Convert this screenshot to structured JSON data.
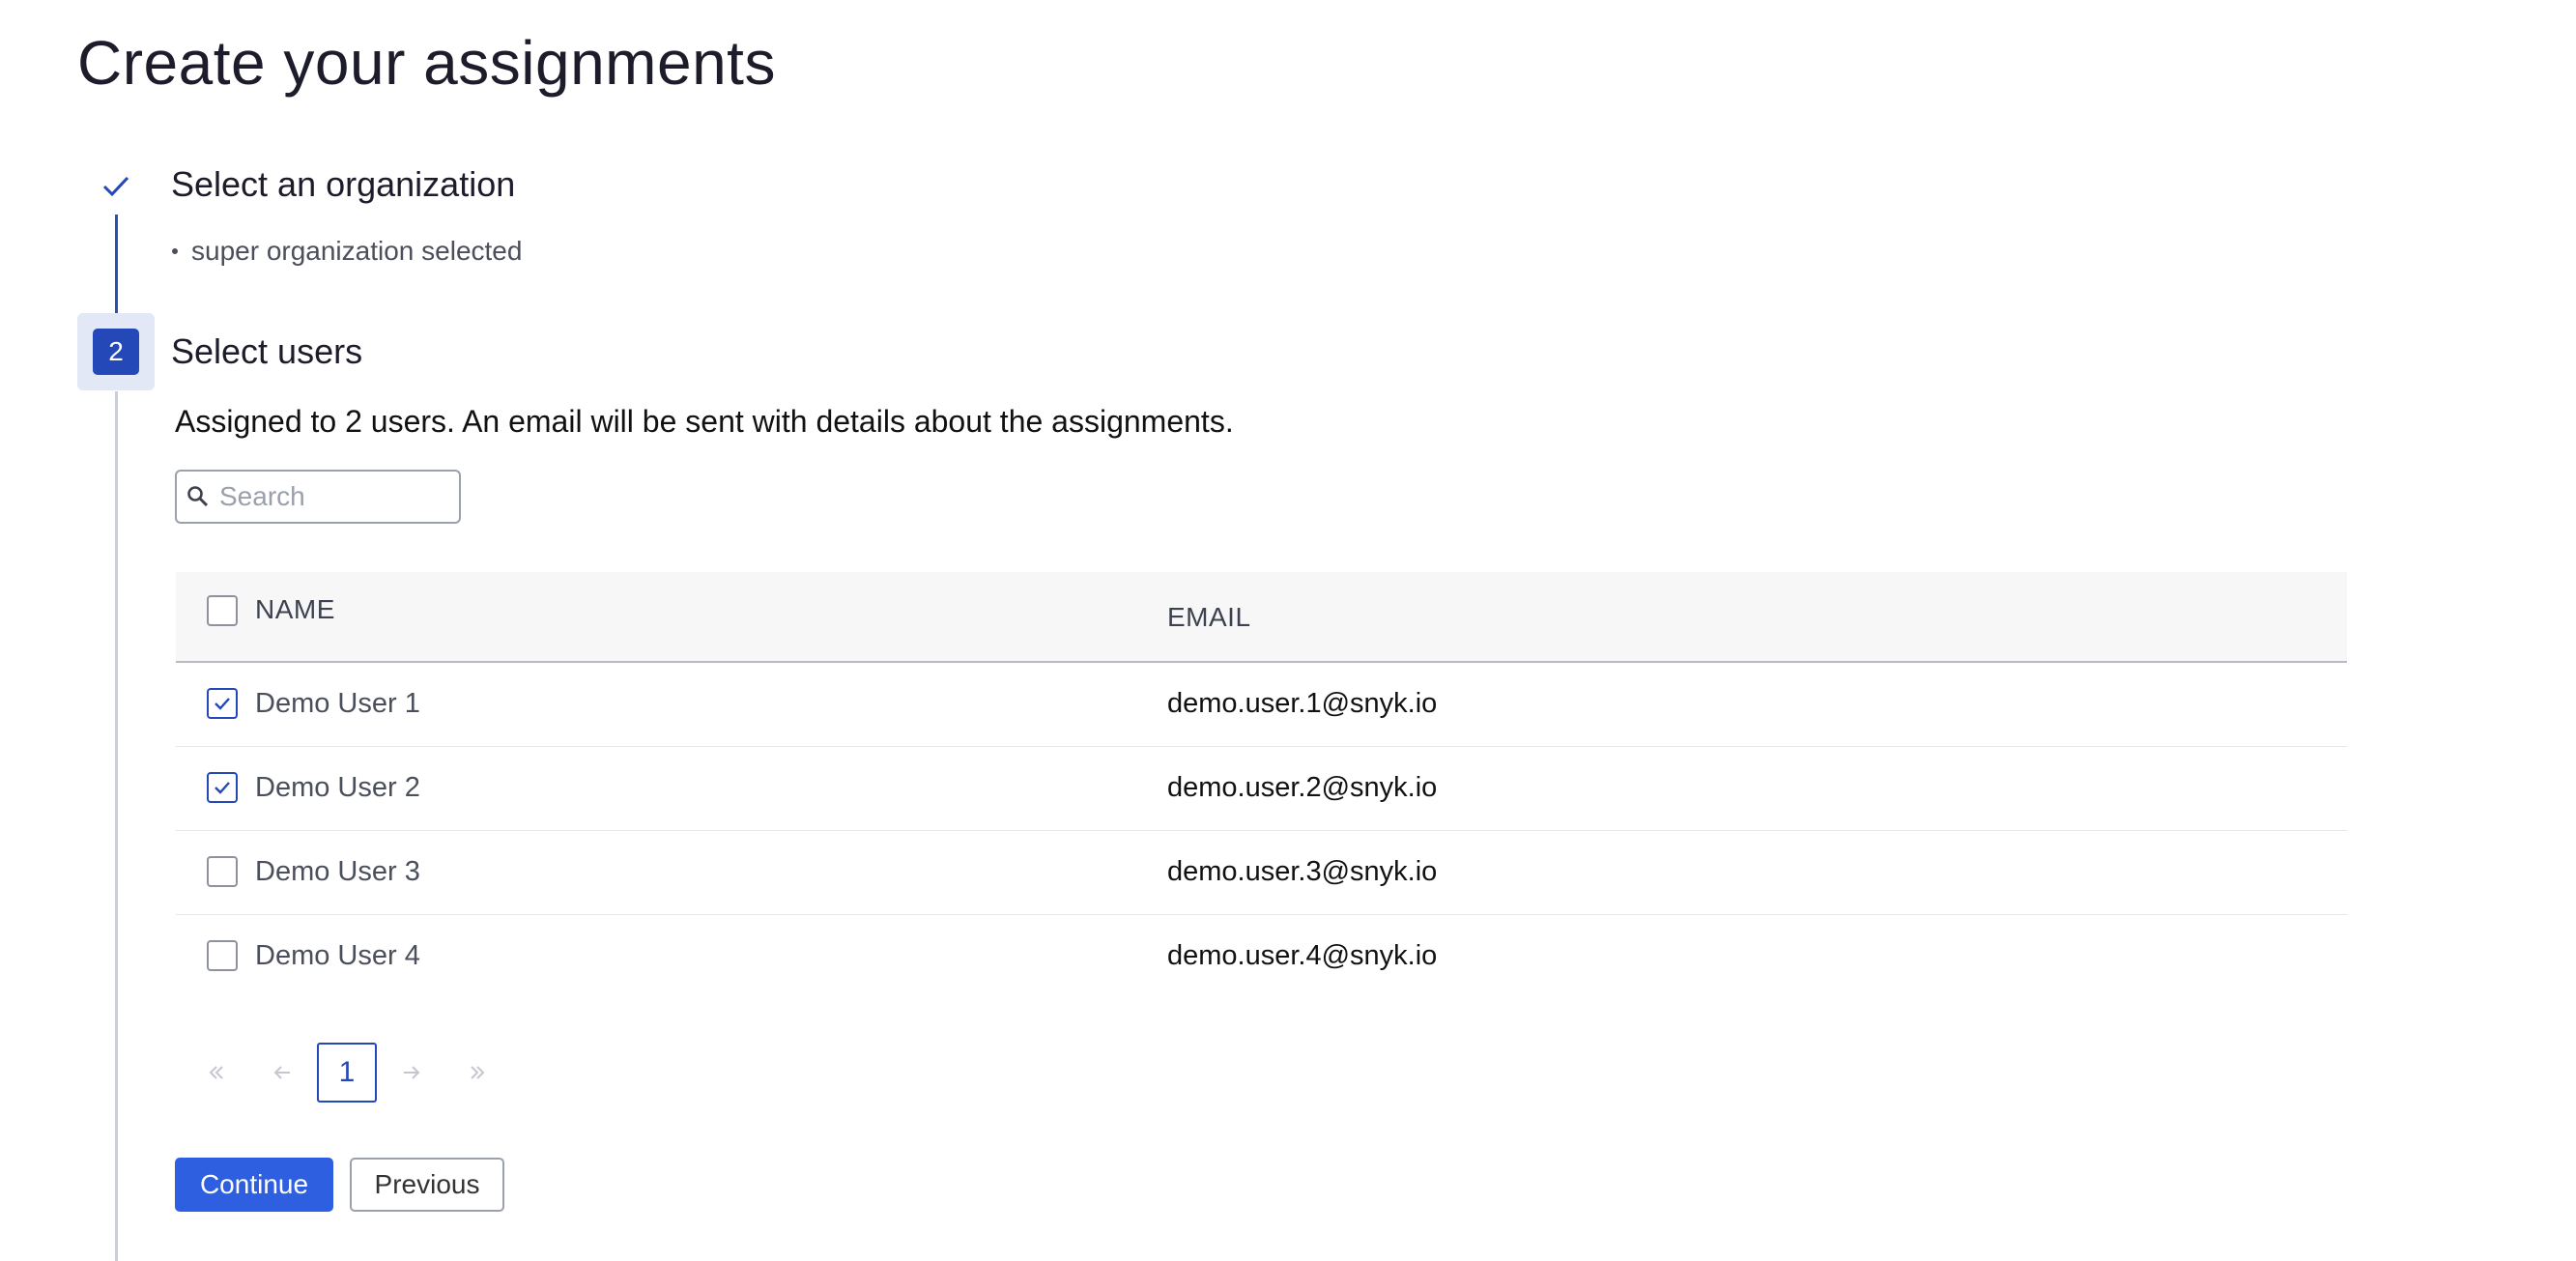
{
  "page": {
    "title": "Create your assignments"
  },
  "steps": [
    {
      "status": "done",
      "title": "Select an organization",
      "summary": "super organization selected"
    },
    {
      "status": "active",
      "number": "2",
      "title": "Select users"
    }
  ],
  "assign": {
    "description": "Assigned to 2 users. An email will be sent with details about the assignments."
  },
  "search": {
    "placeholder": "Search",
    "value": ""
  },
  "table": {
    "columns": [
      "NAME",
      "EMAIL"
    ],
    "rows": [
      {
        "name": "Demo User 1",
        "email": "demo.user.1@snyk.io",
        "checked": true
      },
      {
        "name": "Demo User 2",
        "email": "demo.user.2@snyk.io",
        "checked": true
      },
      {
        "name": "Demo User 3",
        "email": "demo.user.3@snyk.io",
        "checked": false
      },
      {
        "name": "Demo User 4",
        "email": "demo.user.4@snyk.io",
        "checked": false
      }
    ]
  },
  "pagination": {
    "current_page": "1",
    "icons": [
      "double-chevron-left-icon",
      "arrow-left-icon",
      "arrow-right-icon",
      "double-chevron-right-icon"
    ]
  },
  "buttons": {
    "continue": "Continue",
    "previous": "Previous"
  },
  "colors": {
    "accent": "#2448b8",
    "primary_button": "#2d5fe0",
    "step_line_done": "#2b4fb3"
  }
}
